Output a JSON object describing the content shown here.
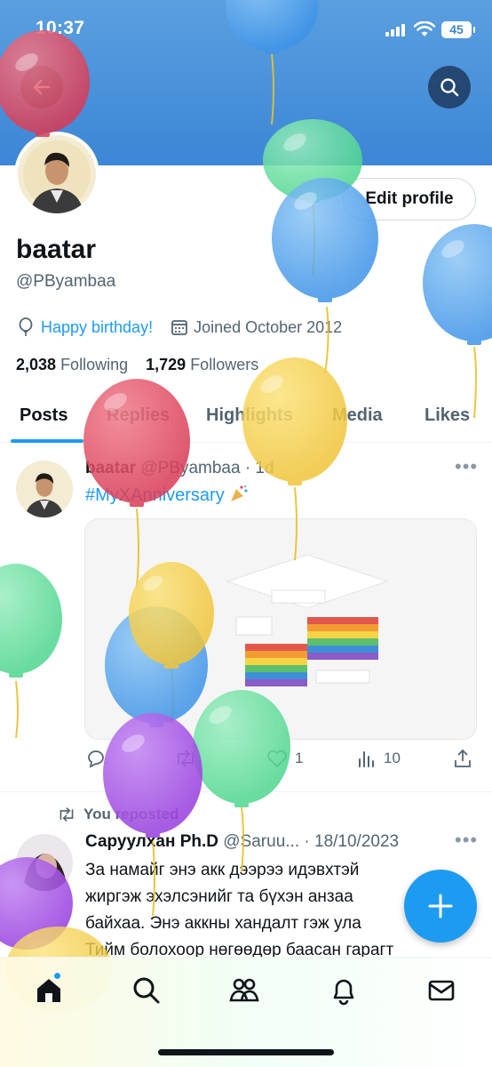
{
  "status_bar": {
    "time": "10:37",
    "battery": "45"
  },
  "profile": {
    "name": "baatar",
    "handle": "@PByambaa",
    "birthday_text": "Happy birthday!",
    "joined_text": "Joined October 2012",
    "following_count": "2,038",
    "following_label": "Following",
    "followers_count": "1,729",
    "followers_label": "Followers",
    "edit_profile_label": "Edit profile"
  },
  "tabs": [
    {
      "label": "Posts",
      "active": true
    },
    {
      "label": "Replies"
    },
    {
      "label": "Highlights"
    },
    {
      "label": "Media"
    },
    {
      "label": "Likes"
    }
  ],
  "tweet1": {
    "author": "baatar",
    "handle": "@PByambaa",
    "time": "· 1d",
    "hashtag": "#MyXAnniversary",
    "replies": "",
    "reposts": "",
    "likes": "1",
    "views": "10"
  },
  "tweet2": {
    "repost_label": "You reposted",
    "author": "Саруулхан Ph.D",
    "handle": "@Saruu...",
    "date": "· 18/10/2023",
    "text_lines": [
      "За намайг энэ акк дээрээ идэвхтэй",
      "жиргэж эхэлсэнийг та бүхэн анзаа",
      "байхаа. Энэ аккны хандалт гэж ула",
      "Тийм болохоор нөгөөдөр баасан гарагт"
    ]
  },
  "icons": {
    "back": "back-arrow-icon",
    "search": "search-icon",
    "location": "balloon-location-icon",
    "calendar": "calendar-icon",
    "nav": [
      "home-icon",
      "search-icon",
      "communities-icon",
      "notifications-icon",
      "messages-icon"
    ]
  },
  "colors": {
    "accent": "#1d9bf0",
    "banner": "#3d86d6",
    "text": "#0f1419",
    "muted": "#536471"
  }
}
